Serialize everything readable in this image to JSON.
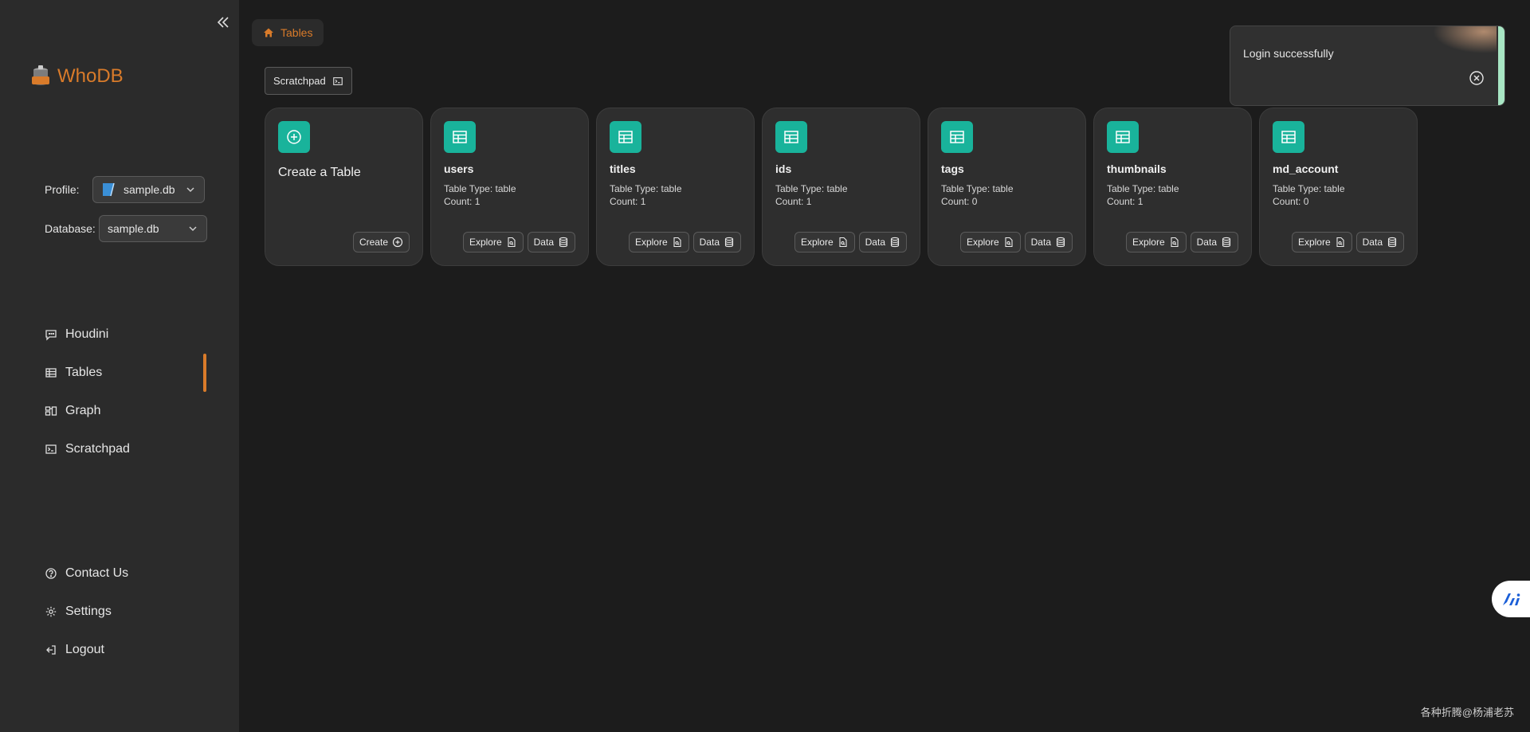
{
  "app": {
    "name": "WhoDB"
  },
  "sidebar": {
    "profile_label": "Profile:",
    "profile_value": "sample.db",
    "database_label": "Database:",
    "database_value": "sample.db",
    "nav": [
      {
        "label": "Houdini",
        "icon": "chat-icon"
      },
      {
        "label": "Tables",
        "icon": "table-icon",
        "active": true
      },
      {
        "label": "Graph",
        "icon": "graph-icon"
      },
      {
        "label": "Scratchpad",
        "icon": "terminal-icon"
      }
    ],
    "bottom_nav": [
      {
        "label": "Contact Us",
        "icon": "help-icon"
      },
      {
        "label": "Settings",
        "icon": "gear-icon"
      },
      {
        "label": "Logout",
        "icon": "logout-icon"
      }
    ]
  },
  "breadcrumb": {
    "label": "Tables"
  },
  "toolbar": {
    "scratchpad_label": "Scratchpad"
  },
  "create_card": {
    "title": "Create a Table",
    "button": "Create"
  },
  "tables": [
    {
      "name": "users",
      "type": "Table Type: table",
      "count": "Count: 1"
    },
    {
      "name": "titles",
      "type": "Table Type: table",
      "count": "Count: 1"
    },
    {
      "name": "ids",
      "type": "Table Type: table",
      "count": "Count: 1"
    },
    {
      "name": "tags",
      "type": "Table Type: table",
      "count": "Count: 0"
    },
    {
      "name": "thumbnails",
      "type": "Table Type: table",
      "count": "Count: 1"
    },
    {
      "name": "md_account",
      "type": "Table Type: table",
      "count": "Count: 0"
    }
  ],
  "card_buttons": {
    "explore": "Explore",
    "data": "Data"
  },
  "toast": {
    "message": "Login successfully"
  },
  "watermark": "各种折腾@杨浦老苏",
  "colors": {
    "accent": "#d97b2a",
    "teal": "#19b39b",
    "toast_bar": "#a8e6c4"
  }
}
